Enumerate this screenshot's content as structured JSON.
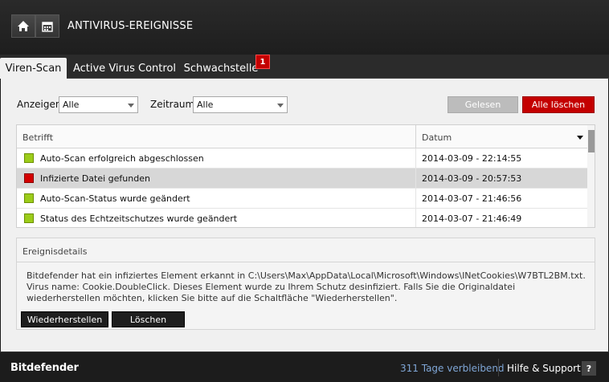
{
  "header": {
    "title": "ANTIVIRUS-EREIGNISSE",
    "icons": [
      "home-icon",
      "calendar-icon"
    ]
  },
  "tabs": [
    {
      "label": "Viren-Scan",
      "active": true
    },
    {
      "label": "Active Virus Control",
      "active": false
    },
    {
      "label": "Schwachstelle",
      "active": false,
      "badge": "1"
    }
  ],
  "filters": {
    "show_label": "Anzeigen",
    "show_value": "Alle",
    "period_label": "Zeitraum:",
    "period_value": "Alle"
  },
  "actions": {
    "read_label": "Gelesen",
    "delete_all_label": "Alle löschen"
  },
  "table": {
    "col_subject": "Betrifft",
    "col_date": "Datum",
    "rows": [
      {
        "status": "green",
        "text": "Auto-Scan erfolgreich abgeschlossen",
        "date": "2014-03-09 - 22:14:55"
      },
      {
        "status": "red",
        "text": "Infizierte Datei gefunden",
        "date": "2014-03-09 - 20:57:53"
      },
      {
        "status": "green",
        "text": "Auto-Scan-Status wurde geändert",
        "date": "2014-03-07 - 21:46:56"
      },
      {
        "status": "green",
        "text": "Status des Echtzeitschutzes wurde geändert",
        "date": "2014-03-07 - 21:46:49"
      }
    ]
  },
  "details": {
    "title": "Ereignisdetails",
    "text": "Bitdefender hat ein infiziertes Element erkannt in C:\\Users\\Max\\AppData\\Local\\Microsoft\\Windows\\INetCookies\\W7BTL2BM.txt. Virus name: Cookie.DoubleClick. Dieses Element wurde zu Ihrem Schutz desinfiziert. Falls Sie die Originaldatei wiederherstellen möchten, klicken Sie bitte auf die Schaltfläche \"Wiederherstellen\".",
    "restore_label": "Wiederherstellen",
    "delete_label": "Löschen"
  },
  "footer": {
    "brand": "Bitdefender",
    "days_remaining": "311 Tage verbleibend",
    "help_label": "Hilfe & Support",
    "question_label": "?"
  },
  "colors": {
    "accent_red": "#c40000",
    "ok_green": "#9ccc1a",
    "link_blue": "#7fa6d6"
  }
}
